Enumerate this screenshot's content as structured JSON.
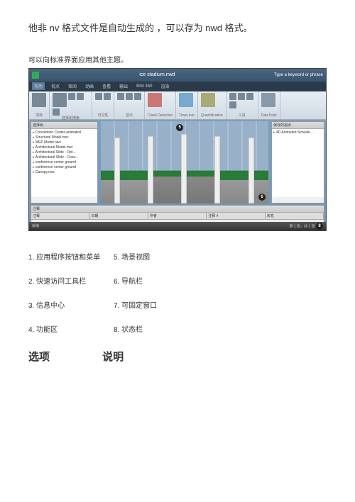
{
  "doc": {
    "title_line": "他非 nv 格式文件是自动生成的 ，可以存为 nwd 格式。",
    "theme_caption": "可以向标准界面应用其他主题。"
  },
  "app": {
    "window_title": "ice stadium.nwd",
    "title_right": "Type a keyword or phrase",
    "tabs": [
      "常用",
      "视点",
      "审阅",
      "动画",
      "查看",
      "输出",
      "BIM 360",
      "渲染"
    ],
    "ribbon_groups": [
      {
        "label": "项目",
        "icons": [
          "lg"
        ]
      },
      {
        "label": "选择和搜索",
        "icons": [
          "lg",
          "s",
          "s",
          "s",
          "s",
          "s",
          "s"
        ]
      },
      {
        "label": "可见性",
        "icons": [
          "s",
          "s",
          "s"
        ]
      },
      {
        "label": "显示",
        "icons": [
          "s",
          "s",
          "s",
          "s"
        ]
      },
      {
        "label": "",
        "icons": [
          "lg"
        ],
        "name": "Clash Detective"
      },
      {
        "label": "",
        "icons": [
          "lg"
        ],
        "name": "TimeLiner"
      },
      {
        "label": "",
        "icons": [
          "lg"
        ],
        "name": "Quantification"
      },
      {
        "label": "工具",
        "icons": [
          "s",
          "s",
          "s",
          "s",
          "s",
          "s"
        ]
      },
      {
        "label": "",
        "icons": [
          "lg"
        ],
        "name": "DataTools"
      }
    ],
    "left_panel": {
      "title": "选择树",
      "items": [
        "Convention Center-animated",
        "Structural Model.nwc",
        "MEP Model.nwc",
        "Architectural Model.nwc",
        "Architectural Slide - Opt...",
        "Architectural Slide - Cons...",
        "conference center ground",
        "conference center ground",
        "Canopy.nwc"
      ]
    },
    "right_panel": {
      "title": "保存的视点",
      "item": "4D Animated Simulati..."
    },
    "bottom_panel": {
      "title": "注释",
      "cols": [
        "注释",
        "日期",
        "作者",
        "注释 #",
        "状态"
      ]
    },
    "status_left": "就绪",
    "status_right": "第 1 张，共 1 张"
  },
  "callouts": {
    "c5": "5",
    "c6": "6",
    "c8": "8"
  },
  "legend": {
    "r1a": "1. 应用程序按钮和菜单",
    "r1b": "5. 场景视图",
    "r2a": "2. 快速访问工具栏",
    "r2b": "6. 导航栏",
    "r3a": "3. 信息中心",
    "r3b": "7. 可固定窗口",
    "r4a": "4. 功能区",
    "r4b": "8. 状态栏"
  },
  "section": {
    "opt": "选项",
    "desc": "说明"
  }
}
